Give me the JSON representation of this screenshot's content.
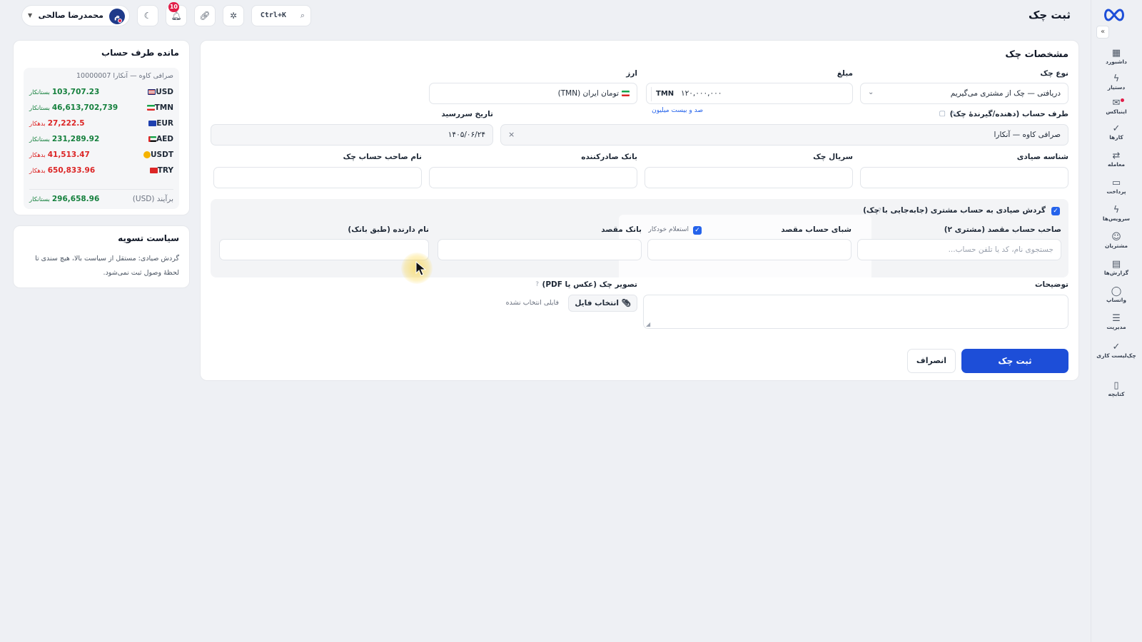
{
  "header": {
    "title": "ثبت چک",
    "user": {
      "name": "محمدرضا صالحی",
      "initial": "م"
    },
    "notifications_count": "10",
    "search_shortcut": "Ctrl+K"
  },
  "rail": {
    "items": [
      {
        "label": "داشبورد",
        "icon": "dashboard-icon"
      },
      {
        "label": "دستیار",
        "icon": "bolt-icon"
      },
      {
        "label": "اینباکس",
        "icon": "inbox-icon"
      },
      {
        "label": "کارها",
        "icon": "check-icon"
      },
      {
        "label": "معامله",
        "icon": "exchange-icon"
      },
      {
        "label": "پرداخت",
        "icon": "payment-icon"
      },
      {
        "label": "سرویس‌ها",
        "icon": "bolt-icon"
      },
      {
        "label": "مشتریان",
        "icon": "users-icon"
      },
      {
        "label": "گزارش‌ها",
        "icon": "report-icon"
      },
      {
        "label": "واتساپ",
        "icon": "chat-icon"
      },
      {
        "label": "مدیریت",
        "icon": "sliders-icon"
      },
      {
        "label": "چک‌لیست کاری",
        "icon": "checklist-icon"
      },
      {
        "label": "کتابچه",
        "icon": "book-icon"
      }
    ]
  },
  "balance": {
    "title": "مانده طرف حساب",
    "subtitle": "صرافی کاوه — آنکارا 10000007",
    "rows": [
      {
        "currency": "USD",
        "value": "103,707.23",
        "state": "بستانکار",
        "positive": true
      },
      {
        "currency": "TMN",
        "value": "46,613,702,739",
        "state": "بستانکار",
        "positive": true
      },
      {
        "currency": "EUR",
        "value": "27,222.5",
        "state": "بدهکار",
        "positive": false
      },
      {
        "currency": "AED",
        "value": "231,289.92",
        "state": "بستانکار",
        "positive": true
      },
      {
        "currency": "USDT",
        "value": "41,513.47",
        "state": "بدهکار",
        "positive": false
      },
      {
        "currency": "TRY",
        "value": "650,833.96",
        "state": "بدهکار",
        "positive": false
      }
    ],
    "total_label": "برآیند (USD)",
    "total_value": "296,658.96",
    "total_state": "بستانکار"
  },
  "policy": {
    "title": "سیاست تسویه",
    "text": "گردش صیادی: مستقل از سیاست بالا، هیچ سندی تا لحظهٔ وصول ثبت نمی‌شود."
  },
  "form": {
    "title": "مشخصات چک",
    "check_type": {
      "label": "نوع چک",
      "value": "دریافتی — چک از مشتری می‌گیریم"
    },
    "amount": {
      "label": "مبلغ",
      "value": "۱۲۰,۰۰۰,۰۰۰",
      "unit": "TMN",
      "words": "صد و بیست میلیون"
    },
    "currency": {
      "label": "ارز",
      "value": "تومان ایران (TMN)"
    },
    "counterparty": {
      "label": "طرف حساب (دهنده/گیرندهٔ چک)",
      "value": "صرافی کاوه — آنکارا"
    },
    "due_date": {
      "label": "تاریخ سررسید",
      "value": "۱۴۰۵/۰۶/۲۴"
    },
    "sayadi_id": {
      "label": "شناسه صیادی"
    },
    "serial": {
      "label": "سریال چک"
    },
    "issuer_bank": {
      "label": "بانک صادرکننده"
    },
    "holder_name": {
      "label": "نام صاحب حساب چک"
    },
    "sayadi_transfer": {
      "label": "گردش صیادی به حساب مشتری (جابه‌جایی با چک)"
    },
    "dest_owner": {
      "label": "صاحب حساب مقصد (مشتری ۲)",
      "placeholder": "جستجوی نام، کد یا تلفن حساب..."
    },
    "dest_sheba": {
      "label": "شبای حساب مقصد"
    },
    "auto_inquiry": {
      "label": "استعلام خودکار"
    },
    "dest_bank": {
      "label": "بانک مقصد"
    },
    "bank_holder_name": {
      "label": "نام دارنده (طبق بانک)"
    },
    "notes": {
      "label": "توضیحات"
    },
    "image": {
      "label": "تصویر چک (عکس یا PDF)",
      "button": "انتخاب فایل",
      "status": "فایلی انتخاب نشده"
    },
    "submit": "ثبت چک",
    "cancel": "انصراف"
  }
}
